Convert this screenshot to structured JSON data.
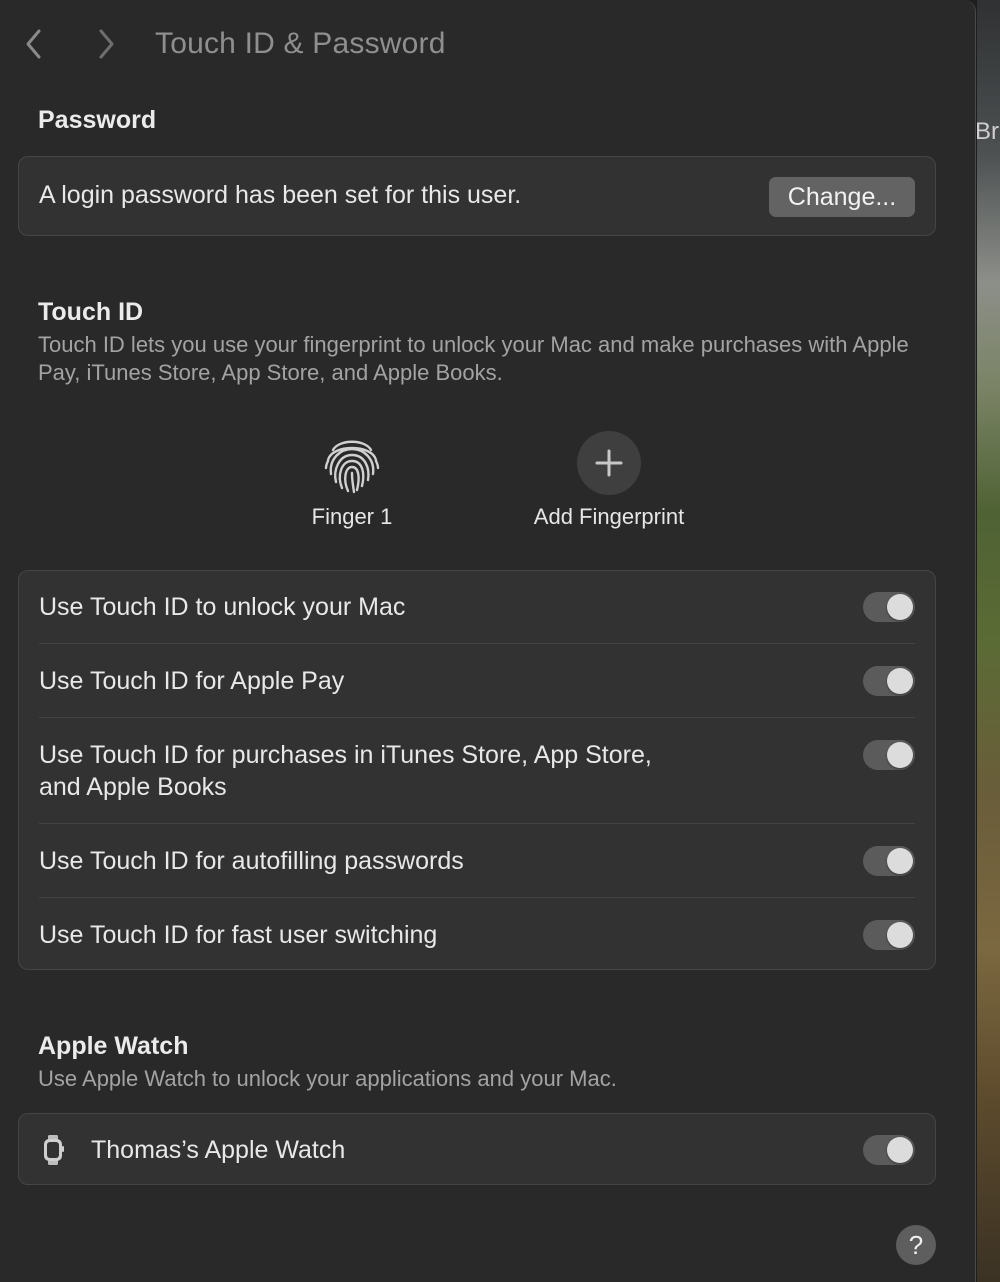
{
  "window": {
    "title": "Touch ID & Password"
  },
  "desktop": {
    "partial_text": "Br"
  },
  "password": {
    "heading": "Password",
    "status_text": "A login password has been set for this user.",
    "change_label": "Change..."
  },
  "touch_id": {
    "heading": "Touch ID",
    "description": "Touch ID lets you use your fingerprint to unlock your Mac and make purchases with Apple Pay, iTunes Store, App Store, and Apple Books.",
    "fingerprints": [
      {
        "label": "Finger 1",
        "icon": "fingerprint-icon"
      }
    ],
    "add_label": "Add Fingerprint",
    "options": [
      {
        "label": "Use Touch ID to unlock your Mac",
        "enabled": true
      },
      {
        "label": "Use Touch ID for Apple Pay",
        "enabled": true
      },
      {
        "label": "Use Touch ID for purchases in iTunes Store, App Store,",
        "label_line2": "and Apple Books",
        "enabled": true
      },
      {
        "label": "Use Touch ID for autofilling passwords",
        "enabled": true
      },
      {
        "label": "Use Touch ID for fast user switching",
        "enabled": true
      }
    ]
  },
  "apple_watch": {
    "heading": "Apple Watch",
    "description": "Use Apple Watch to unlock your applications and your Mac.",
    "device_name": "Thomas’s Apple Watch",
    "enabled": true
  },
  "help_label": "?",
  "colors": {
    "toggle_track": "#5b5b5b",
    "toggle_knob": "#dcdcdc",
    "card_bg": "#323232",
    "window_bg": "#292929"
  }
}
